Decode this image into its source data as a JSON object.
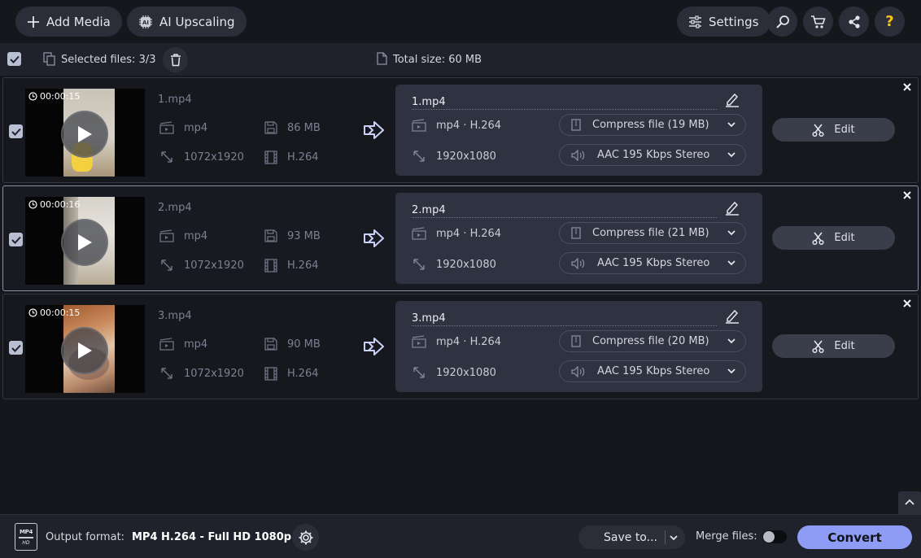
{
  "toolbar": {
    "add_media_label": "Add Media",
    "ai_upscaling_label": "AI Upscaling",
    "settings_label": "Settings",
    "help_label": "?"
  },
  "selection": {
    "selected_label": "Selected files: 3/3",
    "total_size_label": "Total size: 60 MB"
  },
  "files": [
    {
      "duration": "00:00:15",
      "source_name": "1.mp4",
      "source_format": "mp4",
      "source_size": "86 MB",
      "source_resolution": "1072x1920",
      "source_codec": "H.264",
      "output_name": "1.mp4",
      "output_format": "mp4 · H.264",
      "output_resolution": "1920x1080",
      "compress_label": "Compress file (19 MB)",
      "audio_label": "AAC 195 Kbps Stereo",
      "edit_label": "Edit"
    },
    {
      "duration": "00:00:16",
      "source_name": "2.mp4",
      "source_format": "mp4",
      "source_size": "93 MB",
      "source_resolution": "1072x1920",
      "source_codec": "H.264",
      "output_name": "2.mp4",
      "output_format": "mp4 · H.264",
      "output_resolution": "1920x1080",
      "compress_label": "Compress file (21 MB)",
      "audio_label": "AAC 195 Kbps Stereo",
      "edit_label": "Edit"
    },
    {
      "duration": "00:00:15",
      "source_name": "3.mp4",
      "source_format": "mp4",
      "source_size": "90 MB",
      "source_resolution": "1072x1920",
      "source_codec": "H.264",
      "output_name": "3.mp4",
      "output_format": "mp4 · H.264",
      "output_resolution": "1920x1080",
      "compress_label": "Compress file (20 MB)",
      "audio_label": "AAC 195 Kbps Stereo",
      "edit_label": "Edit"
    }
  ],
  "bottom_bar": {
    "format_icon_text": "MP4",
    "format_icon_sub": "HD",
    "output_format_label": "Output format:",
    "output_format_value": "MP4 H.264 - Full HD 1080p",
    "save_to_label": "Save to...",
    "merge_files_label": "Merge files:",
    "merge_enabled": false,
    "convert_label": "Convert"
  },
  "colors": {
    "background": "#15171d",
    "panel": "#2f3240",
    "accent_convert": "#8e9cf5",
    "checkbox": "#b9bfd3"
  }
}
